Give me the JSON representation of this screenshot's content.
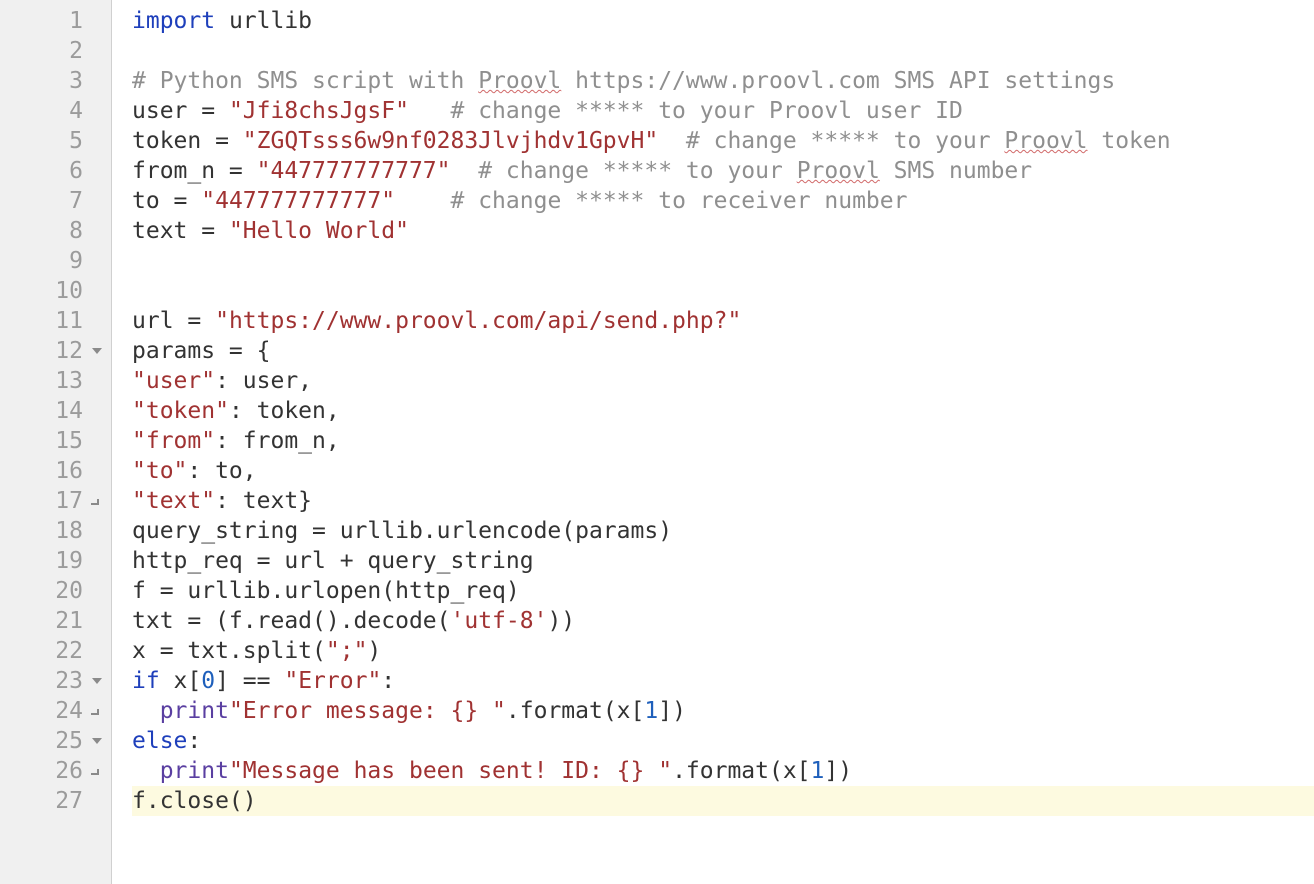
{
  "editor": {
    "line_count": 27,
    "fold_open_lines": [
      12,
      23,
      25
    ],
    "fold_close_lines": [
      17,
      24,
      26
    ],
    "current_line": 27,
    "lines": {
      "1": [
        {
          "t": "import ",
          "c": "kw"
        },
        {
          "t": "urllib",
          "c": "ident"
        }
      ],
      "2": [],
      "3": [
        {
          "t": "# Python SMS script with ",
          "c": "cmt"
        },
        {
          "t": "Proovl",
          "c": "cmt squiggle"
        },
        {
          "t": " https://www.proovl.com SMS API settings",
          "c": "cmt"
        }
      ],
      "4": [
        {
          "t": "user = ",
          "c": "ident"
        },
        {
          "t": "\"Jfi8chsJgsF\"",
          "c": "str"
        },
        {
          "t": "   ",
          "c": "ident"
        },
        {
          "t": "# change ***** to your Proovl user ID",
          "c": "cmt"
        }
      ],
      "5": [
        {
          "t": "token = ",
          "c": "ident"
        },
        {
          "t": "\"ZGQTsss6w9nf0283Jlvjhdv1GpvH\"",
          "c": "str"
        },
        {
          "t": "  ",
          "c": "ident"
        },
        {
          "t": "# change ***** to your ",
          "c": "cmt"
        },
        {
          "t": "Proovl",
          "c": "cmt squiggle"
        },
        {
          "t": " token",
          "c": "cmt"
        }
      ],
      "6": [
        {
          "t": "from_n = ",
          "c": "ident"
        },
        {
          "t": "\"447777777777\"",
          "c": "str"
        },
        {
          "t": "  ",
          "c": "ident"
        },
        {
          "t": "# change ***** to your ",
          "c": "cmt"
        },
        {
          "t": "Proovl",
          "c": "cmt squiggle"
        },
        {
          "t": " SMS number",
          "c": "cmt"
        }
      ],
      "7": [
        {
          "t": "to = ",
          "c": "ident"
        },
        {
          "t": "\"447777777777\"",
          "c": "str"
        },
        {
          "t": "    ",
          "c": "ident"
        },
        {
          "t": "# change ***** to receiver number",
          "c": "cmt"
        }
      ],
      "8": [
        {
          "t": "text = ",
          "c": "ident"
        },
        {
          "t": "\"Hello World\"",
          "c": "str"
        }
      ],
      "9": [],
      "10": [],
      "11": [
        {
          "t": "url = ",
          "c": "ident"
        },
        {
          "t": "\"https://www.proovl.com/api/send.php?\"",
          "c": "str"
        }
      ],
      "12": [
        {
          "t": "params = {",
          "c": "ident"
        }
      ],
      "13": [
        {
          "t": "\"user\"",
          "c": "str"
        },
        {
          "t": ": user,",
          "c": "ident"
        }
      ],
      "14": [
        {
          "t": "\"token\"",
          "c": "str"
        },
        {
          "t": ": token,",
          "c": "ident"
        }
      ],
      "15": [
        {
          "t": "\"from\"",
          "c": "str"
        },
        {
          "t": ": from_n,",
          "c": "ident"
        }
      ],
      "16": [
        {
          "t": "\"to\"",
          "c": "str"
        },
        {
          "t": ": to,",
          "c": "ident"
        }
      ],
      "17": [
        {
          "t": "\"text\"",
          "c": "str"
        },
        {
          "t": ": text}",
          "c": "ident"
        }
      ],
      "18": [
        {
          "t": "query_string = urllib.urlencode(params)",
          "c": "ident"
        }
      ],
      "19": [
        {
          "t": "http_req = url + query_string",
          "c": "ident"
        }
      ],
      "20": [
        {
          "t": "f = urllib.urlopen(http_req)",
          "c": "ident"
        }
      ],
      "21": [
        {
          "t": "txt = (f.read().decode(",
          "c": "ident"
        },
        {
          "t": "'utf-8'",
          "c": "str"
        },
        {
          "t": "))",
          "c": "ident"
        }
      ],
      "22": [
        {
          "t": "x = txt.split(",
          "c": "ident"
        },
        {
          "t": "\";\"",
          "c": "str"
        },
        {
          "t": ")",
          "c": "ident"
        }
      ],
      "23": [
        {
          "t": "if ",
          "c": "kw"
        },
        {
          "t": "x[",
          "c": "ident"
        },
        {
          "t": "0",
          "c": "num"
        },
        {
          "t": "] == ",
          "c": "ident"
        },
        {
          "t": "\"Error\"",
          "c": "str"
        },
        {
          "t": ":",
          "c": "ident"
        }
      ],
      "24": [
        {
          "t": "  ",
          "c": "ident"
        },
        {
          "t": "print",
          "c": "builtin"
        },
        {
          "t": "\"Error message: {} \"",
          "c": "str"
        },
        {
          "t": ".format(x[",
          "c": "ident"
        },
        {
          "t": "1",
          "c": "num"
        },
        {
          "t": "])",
          "c": "ident"
        }
      ],
      "25": [
        {
          "t": "else",
          "c": "kw"
        },
        {
          "t": ":",
          "c": "ident"
        }
      ],
      "26": [
        {
          "t": "  ",
          "c": "ident"
        },
        {
          "t": "print",
          "c": "builtin"
        },
        {
          "t": "\"Message has been sent! ID: {} \"",
          "c": "str"
        },
        {
          "t": ".format(x[",
          "c": "ident"
        },
        {
          "t": "1",
          "c": "num"
        },
        {
          "t": "])",
          "c": "ident"
        }
      ],
      "27": [
        {
          "t": "f.close()",
          "c": "ident"
        }
      ]
    }
  }
}
